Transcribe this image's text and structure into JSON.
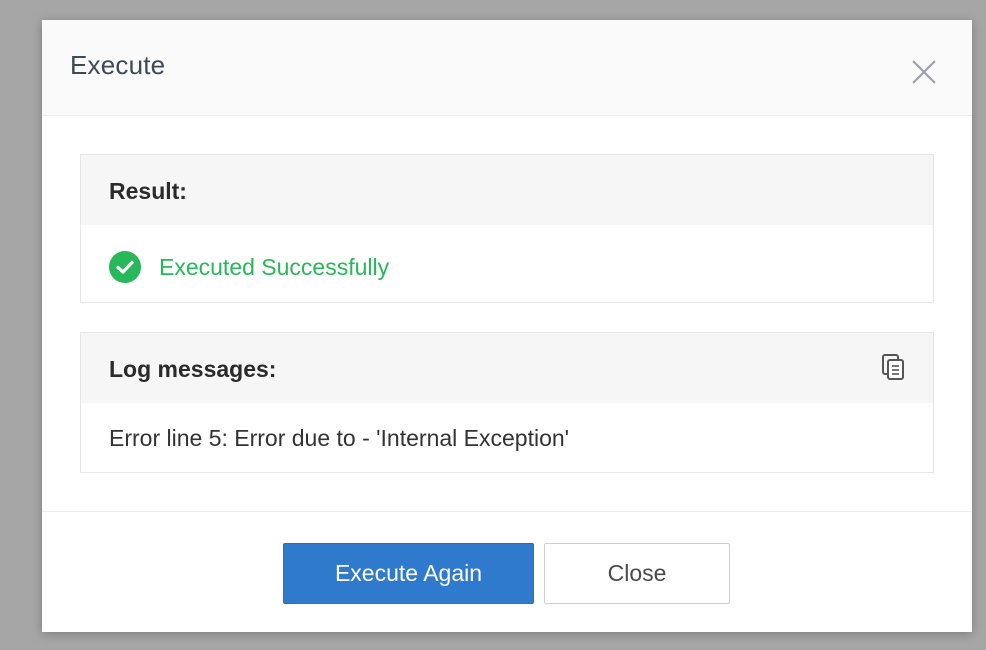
{
  "dialog": {
    "title": "Execute",
    "close_icon": "close-icon"
  },
  "result": {
    "heading": "Result:",
    "status_icon": "check-circle-icon",
    "status_text": "Executed Successfully",
    "status_color": "#27b85a"
  },
  "log": {
    "heading": "Log messages:",
    "copy_icon": "copy-icon",
    "message": "Error line 5: Error due to - 'Internal Exception'"
  },
  "footer": {
    "primary_label": "Execute Again",
    "secondary_label": "Close",
    "primary_color": "#2f7acd"
  }
}
